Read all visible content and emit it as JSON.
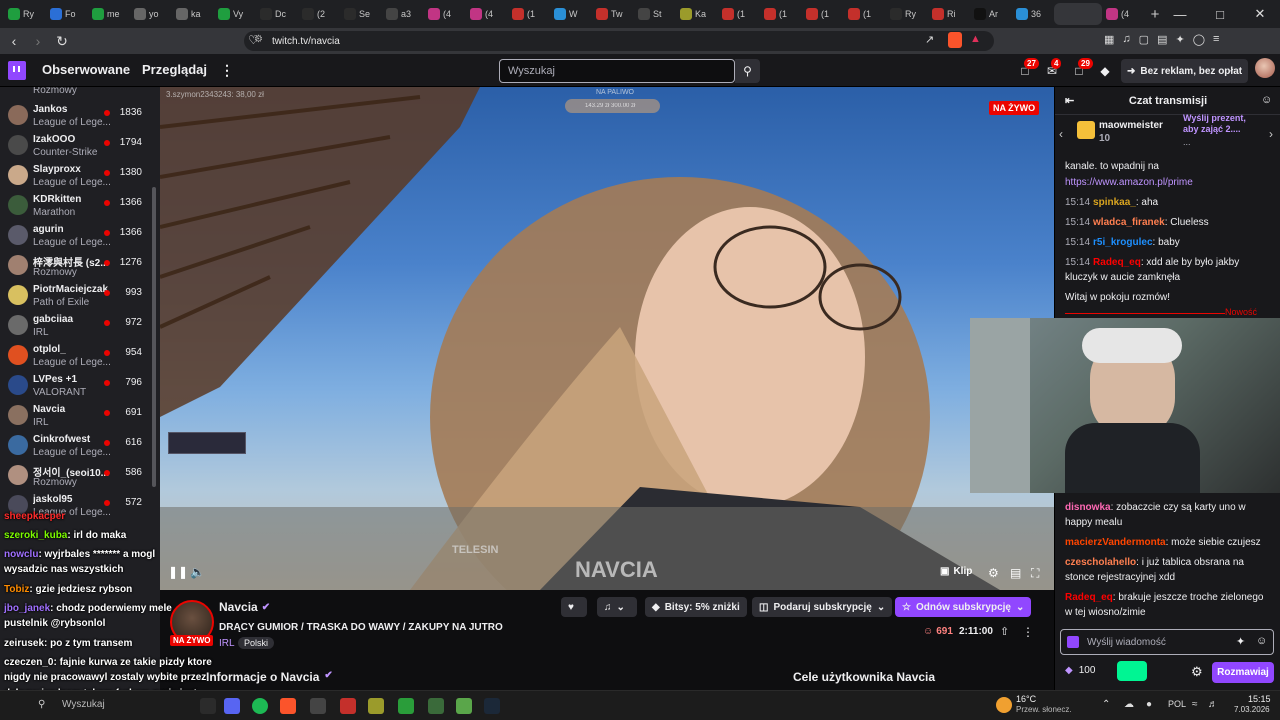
{
  "browser": {
    "tabs": [
      {
        "label": "Ry",
        "color": "#1f9e3f"
      },
      {
        "label": "Fo",
        "color": "#2b6fd6"
      },
      {
        "label": "me",
        "color": "#1f9e3f"
      },
      {
        "label": "yo",
        "color": "#666"
      },
      {
        "label": "ka",
        "color": "#666"
      },
      {
        "label": "Vy",
        "color": "#1f9e3f"
      },
      {
        "label": "Dc",
        "color": "#2b2b2b"
      },
      {
        "label": "(2",
        "color": "#2b2b2b"
      },
      {
        "label": "Se",
        "color": "#2b2b2b"
      },
      {
        "label": "a3",
        "color": "#444"
      },
      {
        "label": "(4",
        "color": "#c13584"
      },
      {
        "label": "(4",
        "color": "#c13584"
      },
      {
        "label": "(1",
        "color": "#c4302b"
      },
      {
        "label": "W",
        "color": "#2a8fd6"
      },
      {
        "label": "Tw",
        "color": "#c4302b"
      },
      {
        "label": "St",
        "color": "#444"
      },
      {
        "label": "Ka",
        "color": "#9b9b2b"
      },
      {
        "label": "(1",
        "color": "#c4302b"
      },
      {
        "label": "(1",
        "color": "#c4302b"
      },
      {
        "label": "(1",
        "color": "#c4302b"
      },
      {
        "label": "(1",
        "color": "#c4302b"
      },
      {
        "label": "Ry",
        "color": "#2b2b2b"
      },
      {
        "label": "Ri",
        "color": "#c4302b"
      },
      {
        "label": "Ar",
        "color": "#111"
      },
      {
        "label": "36",
        "color": "#2a8fd6"
      },
      {
        "label": "",
        "color": "#35363a"
      },
      {
        "label": "(4",
        "color": "#c13584"
      }
    ],
    "url": "twitch.tv/navcia",
    "new_tab": "+"
  },
  "nav": {
    "following": "Obserwowane",
    "browse": "Przeglądaj",
    "search_placeholder": "Wyszukaj",
    "badges": [
      "27",
      "4",
      "29"
    ],
    "no_ads": "Bez reklam, bez opłat"
  },
  "sidebar": {
    "top_game": "Rozmowy",
    "channels": [
      {
        "name": "Jankos",
        "game": "League of Lege...",
        "viewers": "1836",
        "color": "#8a6a5a"
      },
      {
        "name": "IzakOOO",
        "game": "Counter-Strike",
        "viewers": "1794",
        "color": "#4a4a4a"
      },
      {
        "name": "Slayproxx",
        "game": "League of Lege...",
        "viewers": "1380",
        "color": "#caa98a"
      },
      {
        "name": "KDRkitten",
        "game": "Marathon",
        "viewers": "1366",
        "color": "#3b5c3b"
      },
      {
        "name": "agurin",
        "game": "League of Lege...",
        "viewers": "1366",
        "color": "#5a5a6a"
      },
      {
        "name": "梓澪與村長 (s2...",
        "game": "Rozmowy",
        "viewers": "1276",
        "color": "#a08070"
      },
      {
        "name": "PiotrMaciejczak",
        "game": "Path of Exile",
        "viewers": "993",
        "color": "#d8c060"
      },
      {
        "name": "gabciiaa",
        "game": "IRL",
        "viewers": "972",
        "color": "#6a6a6a"
      },
      {
        "name": "otplol_",
        "game": "League of Lege...",
        "viewers": "954",
        "color": "#e05020"
      },
      {
        "name": "LVPes +1",
        "game": "VALORANT",
        "viewers": "796",
        "color": "#2a4a8a"
      },
      {
        "name": "Navcia",
        "game": "IRL",
        "viewers": "691",
        "color": "#8a7060"
      },
      {
        "name": "Cinkrofwest",
        "game": "League of Lege...",
        "viewers": "616",
        "color": "#3a6aa0"
      },
      {
        "name": "정서이_(seoi10...",
        "game": "Rozmowy",
        "viewers": "586",
        "color": "#b09080"
      },
      {
        "name": "jaskol95",
        "game": "League of Lege...",
        "viewers": "572",
        "color": "#4a4a5a"
      }
    ]
  },
  "video": {
    "live": "NA ŻYWO",
    "overlay_top": "3.szymon2343243: 38,00 zł",
    "overlay_center": "NA PALIWO",
    "overlay_bar": "143.29 zł  300.00 zł",
    "watermark": "NAVCIA",
    "telesin": "TELESIN",
    "clip": "Klip"
  },
  "stream": {
    "streamer": "Navcia",
    "title": "DRĄCY GUMIOR / TRASKA DO WAWY / ZAKUPY NA JUTRO",
    "live": "NA ŻYWO",
    "category": "IRL",
    "tag": "Polski",
    "viewers": "691",
    "uptime": "2:11:00",
    "bits": "Bitsy: 5% zniżki",
    "gift": "Podaruj subskrypcję",
    "renew": "Odnów subskrypcję",
    "about": "Informacje o Navcia",
    "goals": "Cele użytkownika Navcia"
  },
  "chat": {
    "title": "Czat transmisji",
    "gift_user": "maowmeister",
    "gift_count": "10",
    "gift_cta": "Wyślij prezent, aby zająć 2....",
    "gift_more": "...",
    "messages": [
      {
        "time": "",
        "user": "",
        "color": "#efeff1",
        "text": "kanale. to wpadnij na"
      },
      {
        "time": "",
        "user": "",
        "color": "#bf94ff",
        "text": "https://www.amazon.pl/prime"
      },
      {
        "time": "15:14",
        "user": "spinkaa_",
        "color": "#daa520",
        "text": ": aha"
      },
      {
        "time": "15:14",
        "user": "wladca_firanek",
        "color": "#ff7f50",
        "text": ": Clueless"
      },
      {
        "time": "15:14",
        "user": "r5i_krogulec",
        "color": "#1e90ff",
        "text": ": baby"
      },
      {
        "time": "15:14",
        "user": "Radeq_eq",
        "color": "#ff0000",
        "text": ": xdd ale by było jakby kluczyk w aucie zamknęła"
      },
      {
        "time": "",
        "user": "",
        "color": "#efeff1",
        "text": "Witaj w pokoju rozmów!"
      }
    ],
    "new_label": "Nowość",
    "lower": [
      {
        "user": "disnowka",
        "color": "#ff69b4",
        "text": ": zobaczcie czy są karty uno w happy mealu"
      },
      {
        "user": "macierzVandermonta",
        "color": "#ff4500",
        "text": ": może siebie czujesz"
      },
      {
        "user": "czescholahello",
        "color": "#ff7f50",
        "text": ": i już tablica obsrana na stonce rejestracyjnej xdd"
      },
      {
        "user": "Radeq_eq",
        "color": "#ff0000",
        "text": ": brakuje jeszcze troche zielonego w tej wiosno/zimie"
      }
    ],
    "input_placeholder": "Wyślij wiadomość",
    "points": "100",
    "send": "Rozmawiaj"
  },
  "overlay_chat": [
    {
      "user": "sheepkacper",
      "color": "#ff2a2a",
      "text": ""
    },
    {
      "user": "szeroki_kuba",
      "color": "#7cfc00",
      "text": ": irl do maka"
    },
    {
      "user": "nowclu",
      "color": "#a070ff",
      "text": ": wyjrbales ******* a mogl"
    },
    {
      "user": "",
      "color": "#ffffff",
      "text": "wysadzic nas wszystkich"
    },
    {
      "user": "Tobiz",
      "color": "#ff8c00",
      "text": ": gzie jedziesz rybson"
    },
    {
      "user": "jbo_janek",
      "color": "#a070ff",
      "text": ": chodz poderwiemy mele"
    },
    {
      "user": "",
      "color": "#ffffff",
      "text": "pustelnik @rybsonlol"
    },
    {
      "user": "zeirusek",
      "color": "#ffffff",
      "text": ": po z tym transem"
    },
    {
      "user": "czeczen_0",
      "color": "#ffffff",
      "text": ": fajnie kurwa ze takie pizdy ktore"
    },
    {
      "user": "",
      "color": "#ffffff",
      "text": "nigdy nie pracowawyl zostaly wybite przez"
    },
    {
      "user": "",
      "color": "#ffffff",
      "text": "dalnow jezdzom takom furkom zycie jest"
    },
    {
      "user": "",
      "color": "#ffffff",
      "text": "uczciwe"
    }
  ],
  "taskbar": {
    "search": "Wyszukaj",
    "weather_temp": "16°C",
    "weather_desc": "Przew. słonecz.",
    "lang": "POL",
    "time": "15:15",
    "date": "7.03.2026"
  }
}
